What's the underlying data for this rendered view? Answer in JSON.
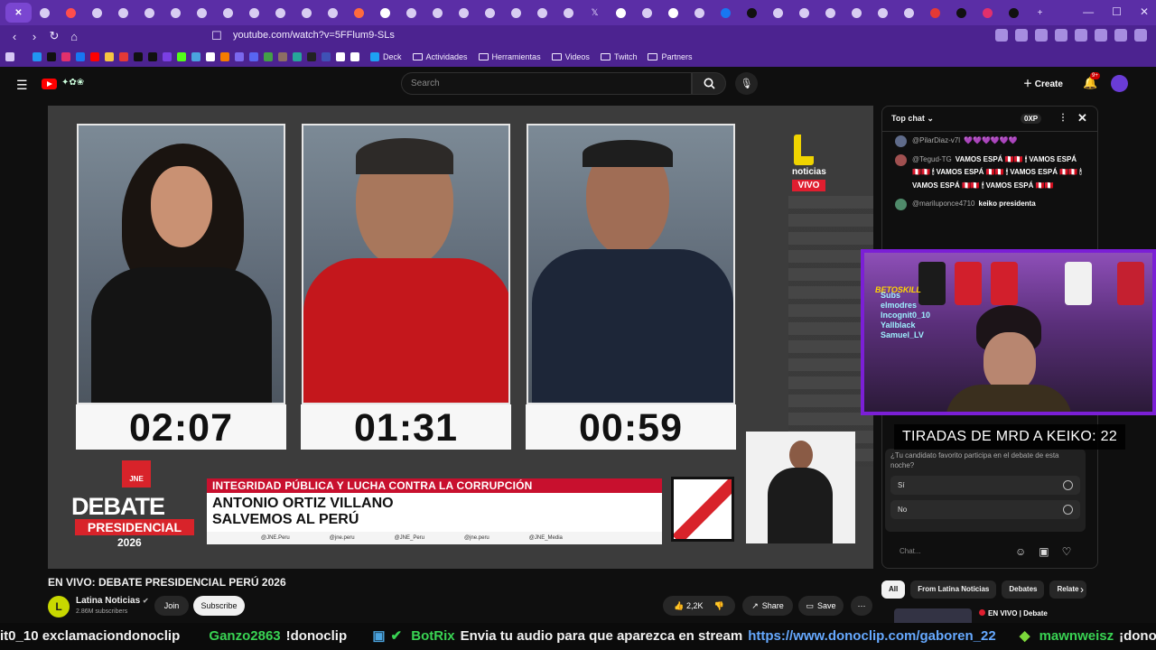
{
  "browser": {
    "url": "youtube.com/watch?v=5FFlum9-SLs",
    "bookmarks": [
      "Deck",
      "Actividades",
      "Herramientas",
      "Videos",
      "Twitch",
      "Partners"
    ]
  },
  "youtube": {
    "search_placeholder": "Search",
    "create_label": "Create",
    "notif_badge": "9+"
  },
  "player": {
    "timers": [
      "02:07",
      "01:31",
      "00:59"
    ],
    "channel_logo_text": "noticias",
    "live_badge": "VIVO",
    "jne_label": "JNE",
    "debate_word": "DEBATE",
    "presidencial_word": "PRESIDENCIAL",
    "year": "2026",
    "topic": "INTEGRIDAD PÚBLICA Y LUCHA CONTRA LA CORRUPCIÓN",
    "candidate_name": "ANTONIO ORTIZ VILLANO",
    "party_name": "SALVEMOS AL PERÚ",
    "socials": [
      "@JNE.Peru",
      "@jne.peru",
      "@JNE_Peru",
      "@jne.peru",
      "@JNE_Media"
    ]
  },
  "video": {
    "title": "EN VIVO: DEBATE PRESIDENCIAL PERÚ 2026",
    "channel_name": "Latina Noticias",
    "subscribers": "2.86M subscribers",
    "join_label": "Join",
    "subscribe_label": "Subscribe",
    "likes": "2,2K",
    "share_label": "Share",
    "save_label": "Save"
  },
  "chat": {
    "mode": "Top chat",
    "xp_label": "0XP",
    "messages": [
      {
        "author": "@PilarDiaz-v7l",
        "text": "💜💜💜💜💜💜"
      },
      {
        "author": "@Tegud-TG",
        "text": "VAMOS ESPÁ 🇵🇪🇵🇪 🕯 VAMOS ESPÁ 🇵🇪🇵🇪 🕯 VAMOS ESPÁ 🇵🇪🇵🇪 🕯 VAMOS ESPÁ 🇵🇪🇵🇪 🕯 VAMOS ESPÁ 🇵🇪🇵🇪 🕯 VAMOS ESPÁ 🇵🇪🇵🇪"
      },
      {
        "author": "@mariluponce4710",
        "text": "keiko presidenta"
      }
    ],
    "poll_question": "¿Tu candidato favorito participa en el debate de esta noche?",
    "poll_options": [
      "Sí",
      "No"
    ],
    "input_placeholder": "Chat..."
  },
  "overlay": {
    "cam_logo": "BETOSKILL",
    "cam_list": [
      "Subs",
      "elmodres",
      "Incognit0_10",
      "Yallblack",
      "Samuel_LV"
    ],
    "tiradas": "TIRADAS DE MRD A KEIKO: 22"
  },
  "related": {
    "chips": [
      "All",
      "From Latina Noticias",
      "Debates",
      "Relate"
    ],
    "first_title": "EN VIVO | Debate"
  },
  "ticker": [
    {
      "user": "",
      "msg": "it0_10 exclamaciondonoclip"
    },
    {
      "user": "Ganzo2863",
      "msg": "!donoclip"
    },
    {
      "user": "BotRix",
      "msg": "Envia tu audio para que aparezca en stream",
      "link": "https://www.donoclip.com/gaboren_22"
    },
    {
      "user": "mawnweisz",
      "msg": "¡donoclip"
    }
  ]
}
